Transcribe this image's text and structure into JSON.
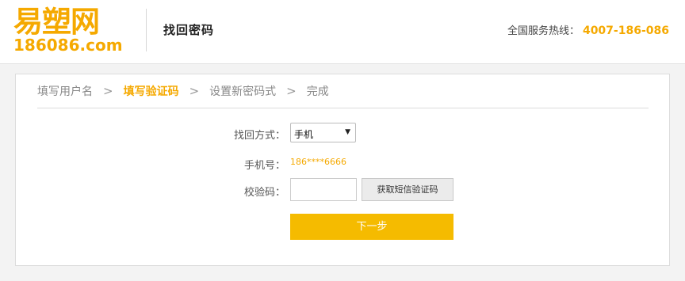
{
  "header": {
    "logo_cn": "易塑网",
    "logo_domain": "186086.com",
    "page_title": "找回密码",
    "hotline_label": "全国服务热线：",
    "hotline_number": "4007-186-086"
  },
  "steps": [
    {
      "label": "填写用户名",
      "active": false
    },
    {
      "label": "填写验证码",
      "active": true
    },
    {
      "label": "设置新密码式",
      "active": false
    },
    {
      "label": "完成",
      "active": false
    }
  ],
  "step_separator": ">",
  "form": {
    "method_label": "找回方式：",
    "method_value": "手机",
    "phone_label": "手机号：",
    "phone_value": "186****6666",
    "code_label": "校验码：",
    "code_value": "",
    "sms_button": "获取短信验证码",
    "next_button": "下一步"
  },
  "colors": {
    "accent": "#f5a900",
    "button": "#f5bb00"
  }
}
